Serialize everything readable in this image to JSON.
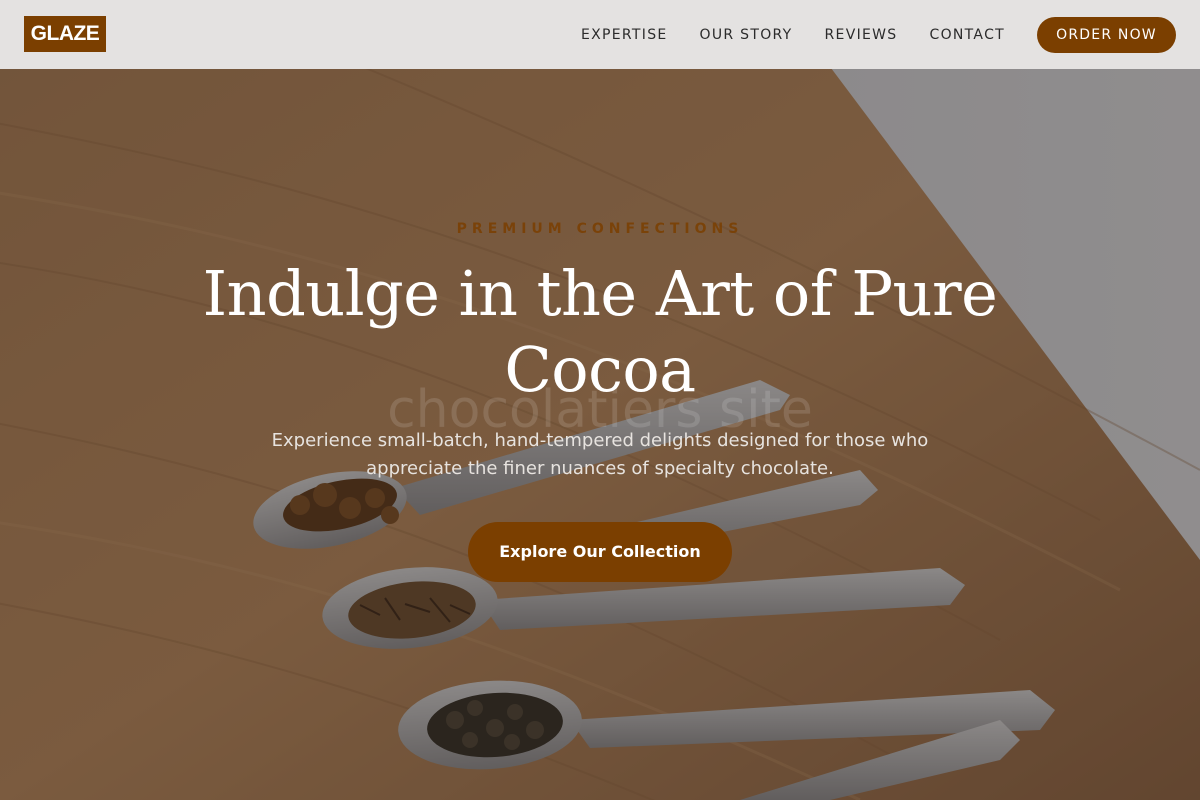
{
  "header": {
    "logo_text": "GLAZE",
    "nav": [
      {
        "label": "EXPERTISE"
      },
      {
        "label": "OUR STORY"
      },
      {
        "label": "REVIEWS"
      },
      {
        "label": "CONTACT"
      }
    ],
    "order_label": "ORDER NOW"
  },
  "hero": {
    "eyebrow": "PREMIUM CONFECTIONS",
    "headline": "Indulge in the Art of Pure Cocoa",
    "watermark": "chocolatiers site",
    "subtitle": "Experience small-batch, hand-tempered delights designed for those who appreciate the finer nuances of specialty chocolate.",
    "cta_label": "Explore Our Collection"
  },
  "colors": {
    "brand": "#7b3f00",
    "header_bg": "#e4e2e1",
    "text_light": "#ffffff"
  }
}
